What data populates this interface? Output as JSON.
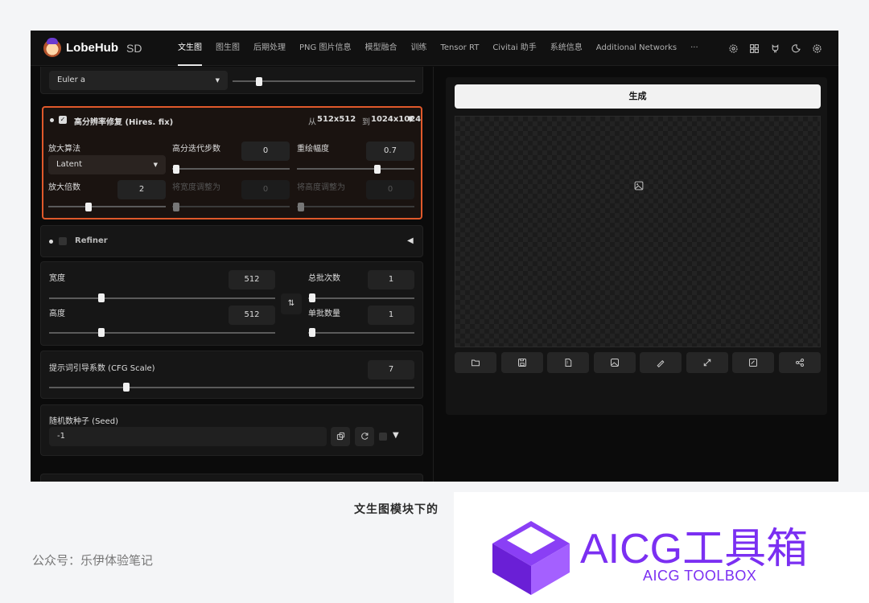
{
  "app": {
    "brand_name": "LobeHub",
    "brand_sub": "SD"
  },
  "nav": {
    "items": [
      {
        "label": "文生图",
        "active": true
      },
      {
        "label": "图生图"
      },
      {
        "label": "后期处理"
      },
      {
        "label": "PNG 图片信息"
      },
      {
        "label": "模型融合"
      },
      {
        "label": "训练"
      },
      {
        "label": "Tensor RT"
      },
      {
        "label": "Civitai 助手"
      },
      {
        "label": "系统信息"
      },
      {
        "label": "Additional Networks"
      },
      {
        "label": "···"
      }
    ],
    "icons": [
      "settings-gear-icon",
      "grid-icon",
      "github-icon",
      "moon-icon",
      "settings-icon"
    ]
  },
  "sampler": {
    "value": "Euler a",
    "steps_level": 0.18
  },
  "hires": {
    "title": "高分辨率修复 (Hires. fix)",
    "enabled": true,
    "from_label": "从",
    "from_value": "512x512",
    "to_label": "到",
    "to_value": "1024x1024",
    "upscaler_label": "放大算法",
    "upscaler_value": "Latent",
    "steps_label": "高分迭代步数",
    "steps_value": "0",
    "denoise_label": "重绘幅度",
    "denoise_value": "0.7",
    "scale_label": "放大倍数",
    "scale_value": "2",
    "resize_w_label": "将宽度调整为",
    "resize_w_value": "0",
    "resize_h_label": "将高度调整为",
    "resize_h_value": "0"
  },
  "refiner": {
    "label": "Refiner"
  },
  "size": {
    "width_label": "宽度",
    "width_value": "512",
    "height_label": "高度",
    "height_value": "512",
    "batch_count_label": "总批次数",
    "batch_count_value": "1",
    "batch_size_label": "单批数量",
    "batch_size_value": "1",
    "swap_icon": "swap-arrows-icon"
  },
  "cfg": {
    "label": "提示词引导系数 (CFG Scale)",
    "value": "7"
  },
  "seed": {
    "label": "随机数种子 (Seed)",
    "value": "-1"
  },
  "output": {
    "generate_label": "生成",
    "tools": [
      "folder-icon",
      "save-icon",
      "zip-icon",
      "send-to-img2img-icon",
      "send-to-inpaint-icon",
      "send-to-extras-icon",
      "send-to-edit-icon",
      "share-icon"
    ]
  },
  "caption": "文生图模块下的",
  "account": "公众号：乐伊体验笔记",
  "watermark": {
    "title": "AICG工具箱",
    "subtitle": "AICG TOOLBOX",
    "color": "#7b2ff2"
  }
}
